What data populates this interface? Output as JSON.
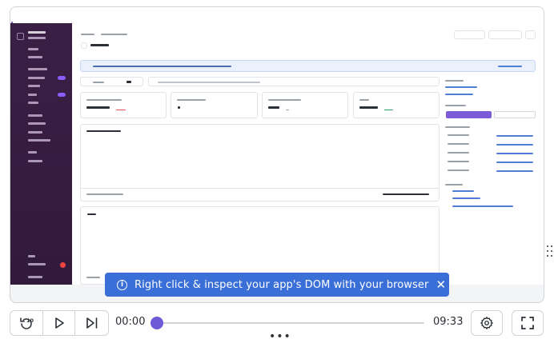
{
  "toast": {
    "message": "Right click & inspect your app's DOM with your browser"
  },
  "player": {
    "current_time": "00:00",
    "total_time": "09:33",
    "progress_percent": 0
  },
  "icons": {
    "skip_back": "skip-back-10-icon",
    "play": "play-icon",
    "skip_forward": "skip-to-end-icon",
    "settings": "gear-icon",
    "fullscreen": "fullscreen-icon",
    "close": "close-icon",
    "info": "info-icon"
  },
  "colors": {
    "accent": "#6e5ad6",
    "toast_bg": "#3a6fd8",
    "sidebar_bg": "#3a1f45"
  }
}
